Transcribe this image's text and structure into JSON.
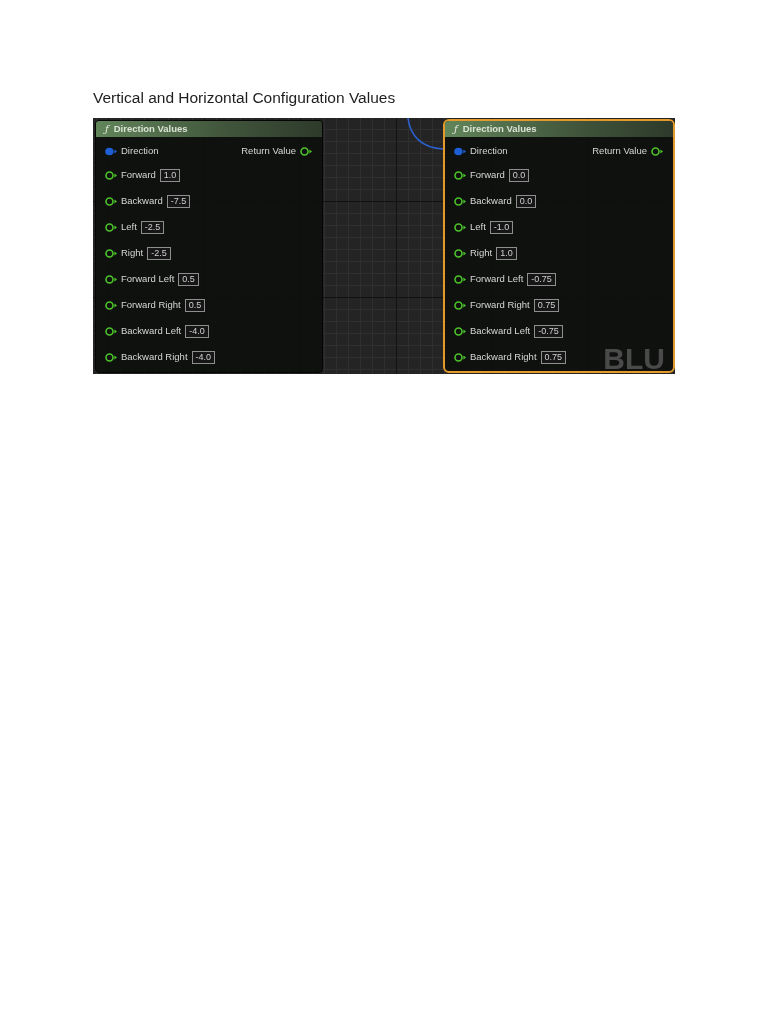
{
  "title": "Vertical and Horizontal Configuration Values",
  "graph": {
    "watermark": "BLU",
    "nodes": [
      {
        "selected": false,
        "icon": "ƒ",
        "title": "Direction Values",
        "inputs": [
          {
            "label": "Direction",
            "color": "#1f5fd6",
            "connected": true
          },
          {
            "label": "Forward",
            "color": "#4cc42a",
            "connected": false,
            "value": "1.0"
          },
          {
            "label": "Backward",
            "color": "#4cc42a",
            "connected": false,
            "value": "-7.5"
          },
          {
            "label": "Left",
            "color": "#4cc42a",
            "connected": false,
            "value": "-2.5"
          },
          {
            "label": "Right",
            "color": "#4cc42a",
            "connected": false,
            "value": "-2.5"
          },
          {
            "label": "Forward Left",
            "color": "#4cc42a",
            "connected": false,
            "value": "0.5"
          },
          {
            "label": "Forward Right",
            "color": "#4cc42a",
            "connected": false,
            "value": "0.5"
          },
          {
            "label": "Backward Left",
            "color": "#4cc42a",
            "connected": false,
            "value": "-4.0"
          },
          {
            "label": "Backward Right",
            "color": "#4cc42a",
            "connected": false,
            "value": "-4.0"
          }
        ],
        "output": {
          "label": "Return Value",
          "color": "#4cc42a",
          "connected": false
        }
      },
      {
        "selected": true,
        "icon": "ƒ",
        "title": "Direction Values",
        "inputs": [
          {
            "label": "Direction",
            "color": "#1f5fd6",
            "connected": true
          },
          {
            "label": "Forward",
            "color": "#4cc42a",
            "connected": false,
            "value": "0.0"
          },
          {
            "label": "Backward",
            "color": "#4cc42a",
            "connected": false,
            "value": "0.0"
          },
          {
            "label": "Left",
            "color": "#4cc42a",
            "connected": false,
            "value": "-1.0"
          },
          {
            "label": "Right",
            "color": "#4cc42a",
            "connected": false,
            "value": "1.0"
          },
          {
            "label": "Forward Left",
            "color": "#4cc42a",
            "connected": false,
            "value": "-0.75"
          },
          {
            "label": "Forward Right",
            "color": "#4cc42a",
            "connected": false,
            "value": "0.75"
          },
          {
            "label": "Backward Left",
            "color": "#4cc42a",
            "connected": false,
            "value": "-0.75"
          },
          {
            "label": "Backward Right",
            "color": "#4cc42a",
            "connected": false,
            "value": "0.75"
          }
        ],
        "output": {
          "label": "Return Value",
          "color": "#4cc42a",
          "connected": false
        }
      }
    ]
  }
}
